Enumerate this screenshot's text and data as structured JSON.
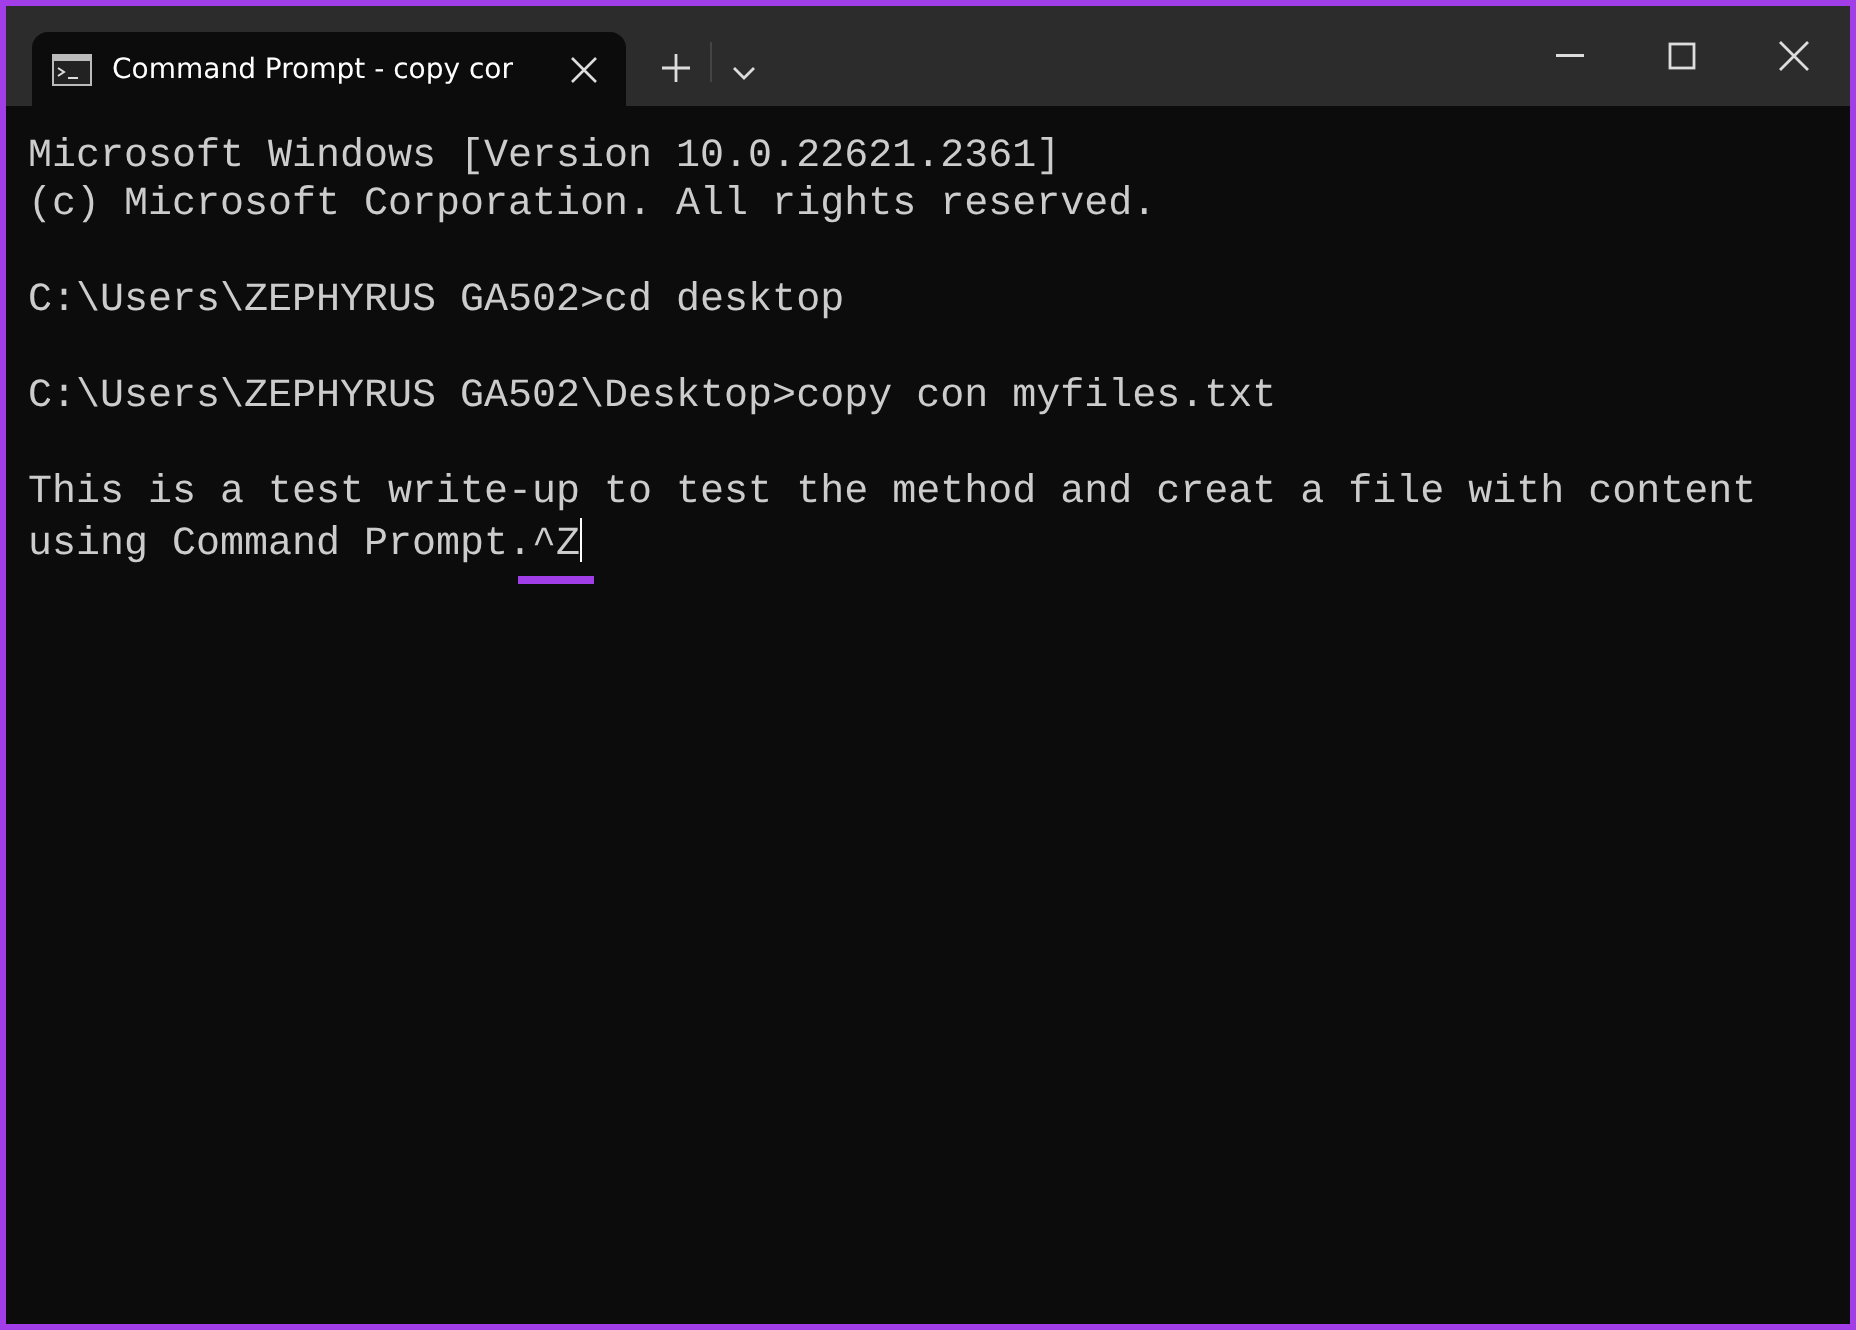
{
  "window": {
    "tab_title": "Command Prompt - copy  cor"
  },
  "terminal": {
    "blocks": [
      [
        {
          "text": "Microsoft Windows [Version 10.0.22621.2361]"
        },
        {
          "text": "(c) Microsoft Corporation. All rights reserved."
        }
      ],
      [
        {
          "text": "C:\\Users\\ZEPHYRUS GA502>cd desktop"
        }
      ],
      [
        {
          "text": "C:\\Users\\ZEPHYRUS GA502\\Desktop>copy con myfiles.txt"
        }
      ],
      [
        {
          "text": "This is a test write-up to test the method and creat a file with content"
        },
        {
          "text": "using Command Prompt.",
          "marked": "^Z",
          "cursor": true
        }
      ]
    ]
  }
}
